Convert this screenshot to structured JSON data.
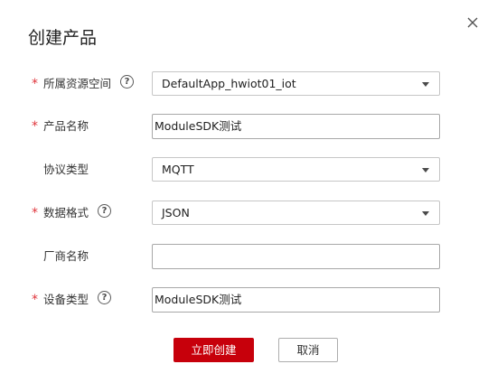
{
  "dialog": {
    "title": "创建产品",
    "close_icon": "close-icon"
  },
  "form": {
    "resource_space": {
      "label": "所属资源空间",
      "required": "*",
      "value": "DefaultApp_hwiot01_iot",
      "help": "?"
    },
    "product_name": {
      "label": "产品名称",
      "required": "*",
      "value": "ModuleSDK测试"
    },
    "protocol_type": {
      "label": "协议类型",
      "value": "MQTT"
    },
    "data_format": {
      "label": "数据格式",
      "required": "*",
      "value": "JSON",
      "help": "?"
    },
    "manufacturer": {
      "label": "厂商名称",
      "value": ""
    },
    "device_type": {
      "label": "设备类型",
      "required": "*",
      "value": "ModuleSDK测试",
      "help": "?"
    }
  },
  "actions": {
    "create_label": "立即创建",
    "cancel_label": "取消"
  },
  "colors": {
    "primary": "#c7000b",
    "required": "#e0353c"
  }
}
